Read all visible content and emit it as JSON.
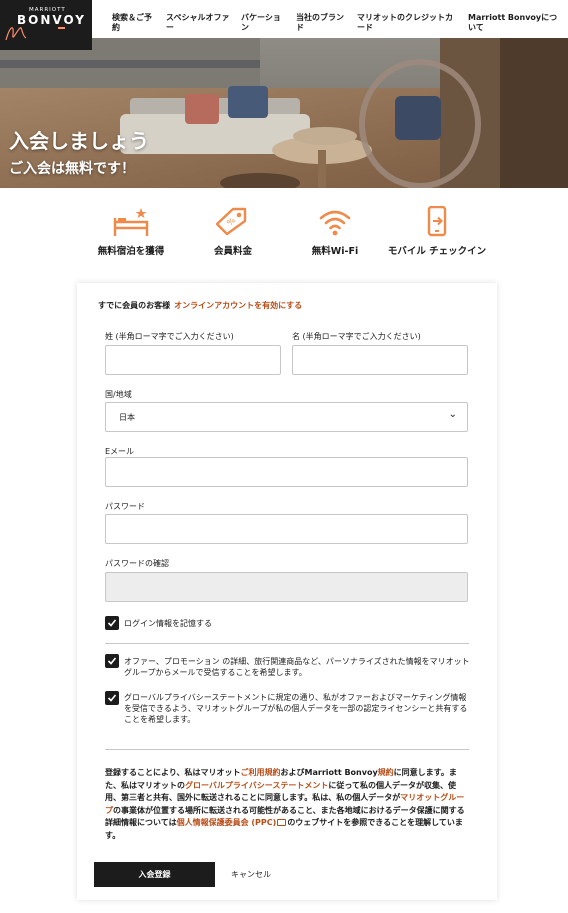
{
  "header": {
    "brand_top": "MARRIOTT",
    "brand": "BONVOY",
    "nav": [
      "検索＆ご予約",
      "スペシャルオファー",
      "バケーション",
      "当社のブランド",
      "マリオットのクレジットカード",
      "Marriott Bonvoyについて"
    ]
  },
  "hero": {
    "title": "入会しましょう",
    "subtitle": "ご入会は無料です！"
  },
  "benefits": [
    {
      "icon": "bed-icon",
      "label": "無料宿泊を獲得"
    },
    {
      "icon": "price-tag-icon",
      "label": "会員料金"
    },
    {
      "icon": "wifi-icon",
      "label": "無料Wi-Fi"
    },
    {
      "icon": "mobile-checkin-icon",
      "label": "モバイル チェックイン"
    }
  ],
  "form": {
    "member_prompt": "すでに会員のお客様",
    "activate_link": "オンラインアカウントを有効にする",
    "last_name_label": "姓 (半角ローマ字でご入力ください)",
    "last_name_value": "",
    "first_name_label": "名 (半角ローマ字でご入力ください)",
    "first_name_value": "",
    "country_label": "国/地域",
    "country_value": "日本",
    "email_label": "Eメール",
    "email_value": "",
    "password_label": "パスワード",
    "password_value": "",
    "confirm_label": "パスワードの確認",
    "confirm_value": "",
    "remember_label": "ログイン情報を記憶する",
    "remember_checked": true,
    "offers_label": "オファー、プロモーション の詳細、旅行関連商品など、パーソナライズされた情報をマリオットグループからメールで受信することを希望します。",
    "offers_checked": true,
    "privacy_label": "グローバルプライバシーステートメントに規定の通り、私がオファーおよびマーケティング情報を受信できるよう、マリオットグループが私の個人データを一部の認定ライセンシーと共有することを希望します。",
    "privacy_checked": true,
    "terms": {
      "t1": "登録することにより、私はマリオット",
      "l1": "ご利用規約",
      "t2": "およびMarriott Bonvoy",
      "l2": "規約",
      "t3": "に同意します。また、私はマリオットの",
      "l3": "グローバルプライバシーステートメント",
      "t4": "に従って私の個人データが収集、使用、第三者と共有、国外に転送されることに同意します。私は、私の個人データが",
      "l4": "マリオットグループ",
      "t5": "の事業体が位置する場所に転送される可能性があること、また各地域におけるデータ保護に関する詳細情報については",
      "l5": "個人情報保護委員会 (PPC)",
      "t6": "のウェブサイトを参照できることを理解しています。"
    },
    "submit_label": "入会登録",
    "cancel_label": "キャンセル"
  },
  "colors": {
    "accent": "#b84c16",
    "dark": "#1c1c1c",
    "icon_orange": "#f08a4b"
  }
}
